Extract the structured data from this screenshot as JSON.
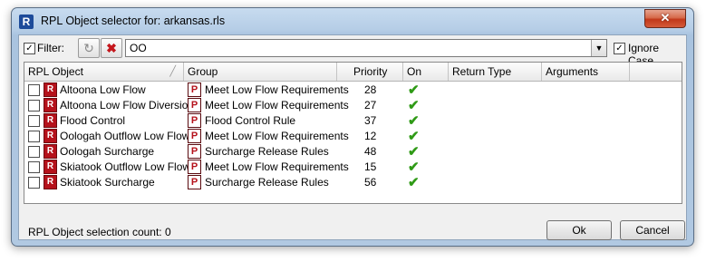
{
  "window": {
    "title": "RPL Object selector for: arkansas.rls",
    "app_icon_glyph": "R",
    "close_glyph": "✕"
  },
  "toolbar": {
    "filter_label": "Filter:",
    "filter_checked": true,
    "filter_value": "OO",
    "refresh_icon": "↻",
    "clear_icon": "✖",
    "ignore_case_label": "Ignore Case",
    "ignore_case_checked": true
  },
  "table": {
    "columns": [
      "RPL Object",
      "Group",
      "Priority",
      "On",
      "Return Type",
      "Arguments"
    ],
    "rows": [
      {
        "object": "Altoona Low Flow",
        "group": "Meet Low Flow Requirements",
        "priority": "28",
        "on": true
      },
      {
        "object": "Altoona Low Flow Diversion",
        "group": "Meet Low Flow Requirements",
        "priority": "27",
        "on": true
      },
      {
        "object": "Flood Control",
        "group": "Flood Control Rule",
        "priority": "37",
        "on": true
      },
      {
        "object": "Oologah Outflow Low Flow",
        "group": "Meet Low Flow Requirements",
        "priority": "12",
        "on": true
      },
      {
        "object": "Oologah Surcharge",
        "group": "Surcharge Release Rules",
        "priority": "48",
        "on": true
      },
      {
        "object": "Skiatook Outflow Low Flow",
        "group": "Meet Low Flow Requirements",
        "priority": "15",
        "on": true
      },
      {
        "object": "Skiatook Surcharge",
        "group": "Surcharge Release Rules",
        "priority": "56",
        "on": true
      }
    ],
    "rule_icon_glyph": "R",
    "group_icon_glyph": "P",
    "on_glyph": "✔"
  },
  "footer": {
    "count_label": "RPL Object selection count: 0",
    "ok_label": "Ok",
    "cancel_label": "Cancel"
  },
  "colors": {
    "title_bar": "#b5cde6",
    "close_button": "#c2381a",
    "check_green": "#2f9a16",
    "icon_red": "#b5121b"
  }
}
